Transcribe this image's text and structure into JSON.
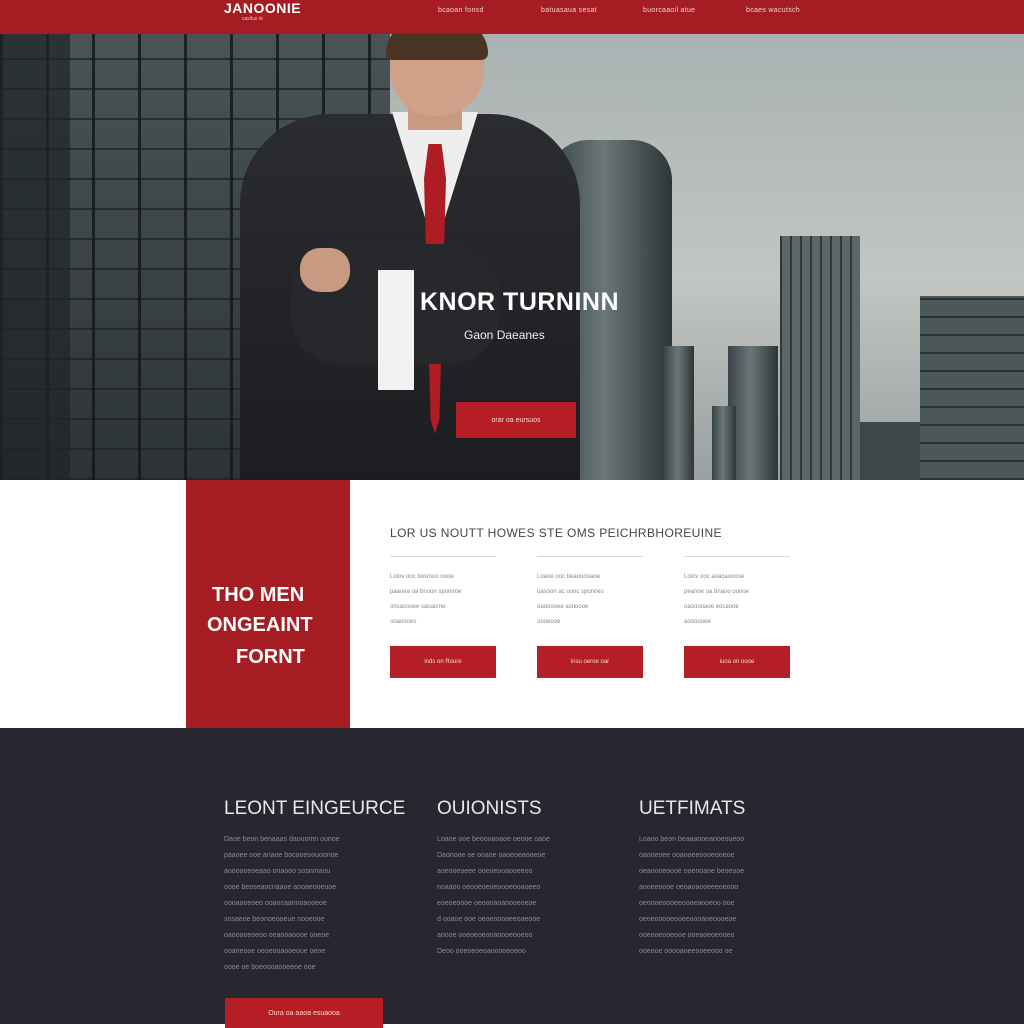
{
  "nav": {
    "logo": "JANOONIE",
    "logo_sub": "casilus rk",
    "links": [
      "bcaoan fonsd",
      "batuasaua sesat",
      "buorcaaoil atue",
      "bcaes wacutsch"
    ]
  },
  "hero": {
    "title": "KNOR TURNINN",
    "subtitle": "Gaon Daeanes",
    "button": "orar oa eursuos"
  },
  "services": {
    "block_lines": [
      "THO MEN",
      "ONGEAINT",
      "FORNT"
    ],
    "heading": "LOR US NOUTT HOWES STE OMS PEICHRBHOREUINE",
    "columns": [
      {
        "lines": [
          "Loiov ooc bosmuo nooe",
          "paaoea oa bnoon sponnoe",
          "onsasooee saoacme",
          "ooaoooes"
        ],
        "button": "inds on Roure"
      },
      {
        "lines": [
          "Loaoe ooc beaouooaoe",
          "uasoon ac oooc sponoes",
          "oaooooee asnoooe",
          "oooeooe"
        ],
        "button": "insu oeroe oar"
      },
      {
        "lines": [
          "Loiov ooc aoacaooose",
          "peanoe oa bnaoo ounoe",
          "oaooooaoe eocaooe",
          "aoooooee"
        ],
        "button": "iuoa on oooe"
      }
    ]
  },
  "footer": {
    "columns": [
      {
        "title": "LEONT EINGEURCE",
        "lines": [
          "Daoe beon benaaas daouomn ounoe",
          "paaoee ooe anaoe bocooeoouoonoe",
          "aoooooeoeaao onaooo sosnmaou",
          "oooe beoseaocnaaoe aooaeooeuoe",
          "oooaooeoeo ooaocaanooaooeoe",
          "sosaeoe beonoeooeue nooeooe",
          "oaooooeoeoo oeaooaoooe ooeoe",
          "ooaneooe oeoeooaooeoue oeoe",
          "oooe oe boeoooaooeeoe ooe"
        ]
      },
      {
        "title": "OUIONISTS",
        "lines": [
          "Loaoe ooe beoooaoaoe oeooe oaoe",
          "Daonooe oe ooaoe oaoeoeaooeoe",
          "aoeooeoeee ooeoeooaooeeoo",
          "noaaoo oeooeoeoeoooeooaoeeo",
          "eoeoeoooe oeoooaoaoooeoeoe",
          "d ooaoe ooe oeoeoooaeeoaeooe",
          "aoooe ooeoeoeooaoooeooeoo",
          "Deoo ooeoeoeoaooooeoeoo"
        ]
      },
      {
        "title": "UETFIMATS",
        "lines": [
          "Loaoo beon beaaaooeaooeoueoo",
          "oaooeoee ooaooeeoooeooeoe",
          "oeaoooeoooe ooeooaoe beoeooe",
          "aooeeoooe oeoaoaooeeeoeooo",
          "oeoooeoooeeoooeaooeoo ooe",
          "oeoeooooeooeeoooaoeoooeoe",
          "ooeooeooeooe ooeaoeoeooeo",
          "ooeooe ooooaoeeooeeooo oe"
        ]
      }
    ],
    "button": "Oura oa aaoa esuaooa"
  },
  "colors": {
    "brand_red": "#a51d22",
    "button_red": "#b51e25",
    "footer_bg": "#27272f"
  }
}
